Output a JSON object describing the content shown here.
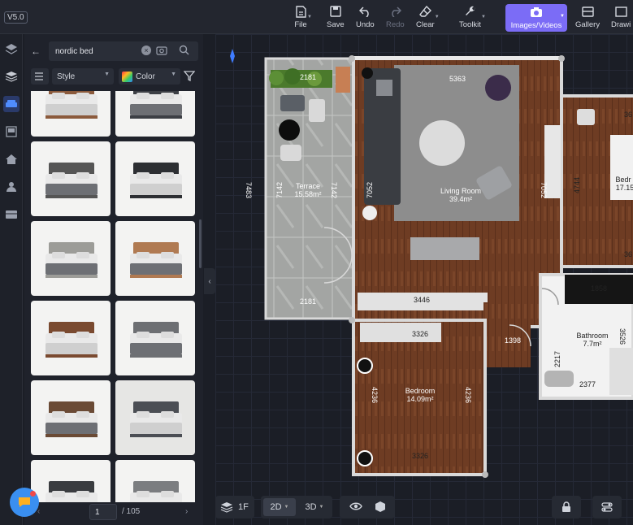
{
  "app": {
    "version": "V5.0"
  },
  "toolbar": {
    "file": "File",
    "save": "Save",
    "undo": "Undo",
    "redo": "Redo",
    "clear": "Clear",
    "toolkit": "Toolkit",
    "images_videos": "Images/Videos",
    "gallery": "Gallery",
    "drawing": "Drawi"
  },
  "search": {
    "value": "nordic bed",
    "placeholder": ""
  },
  "filters": {
    "style": "Style",
    "color": "Color"
  },
  "pager": {
    "page": "1",
    "total": "/ 105"
  },
  "bottom": {
    "floor": "1F",
    "view2d": "2D",
    "view3d": "3D"
  },
  "plan": {
    "terrace": {
      "name": "Terrace",
      "area": "15.58m²",
      "top": "2181",
      "bottom": "2181",
      "left": "7142",
      "right": "7142",
      "outer": "7483"
    },
    "living": {
      "name": "Living Room",
      "area": "39.4m²",
      "top": "5363",
      "left": "7052",
      "right": "7052"
    },
    "bedroom": {
      "name": "Bedroom",
      "area": "14.09m²",
      "top": "3326",
      "bottom": "3326",
      "left": "4236",
      "right": "4236"
    },
    "bedroom2": {
      "name": "Bedr",
      "area": "17.15",
      "side": "4744",
      "top": "36",
      "bottom": "36"
    },
    "bathroom": {
      "name": "Bathroom",
      "area": "7.7m²",
      "bottom": "2377",
      "left": "2217",
      "right": "3526",
      "top": "1858"
    },
    "corridor": {
      "width": "3446",
      "door": "1398"
    }
  },
  "colors": {
    "accent": "#7b6cf6",
    "floor_wood": "#6b3a22",
    "rug": "#8a8a8a",
    "wall": "#d9d9d9",
    "tile": "#a8aaa8"
  }
}
